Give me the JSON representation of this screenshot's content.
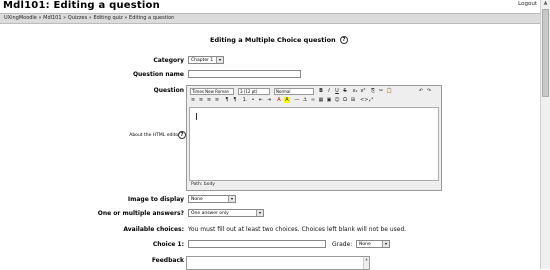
{
  "header": {
    "title": "Mdl101: Editing a question",
    "logout_label": "Logout"
  },
  "breadcrumb": "UXingMoodle » Mdl101 » Quizzes » Editing quiz » Editing a question",
  "form": {
    "title": "Editing a Multiple Choice question",
    "category": {
      "label": "Category",
      "value": "Chapter 1"
    },
    "question_name": {
      "label": "Question name",
      "value": ""
    },
    "question": {
      "label": "Question",
      "editor_help_label": "About the HTML editor",
      "font_value": "Times New Roman",
      "size_value": "3 (12 pt)",
      "style_value": "Normal",
      "path_label": "Path: body"
    },
    "image": {
      "label": "Image to display",
      "value": "None"
    },
    "answers": {
      "label": "One or multiple answers?",
      "value": "One answer only"
    },
    "available_choices": {
      "label": "Available choices:",
      "text": "You must fill out at least two choices. Choices left blank will not be used."
    },
    "choice1": {
      "label": "Choice 1:",
      "value": "",
      "grade_label": "Grade:",
      "grade_value": "None"
    },
    "feedback": {
      "label": "Feedback"
    }
  },
  "toolbar": {
    "row1_buttons": [
      "B",
      "I",
      "U",
      "S",
      "x₂",
      "x²",
      "⎘",
      "✂",
      "📋",
      "↶",
      "↷"
    ],
    "row2_buttons": [
      "≡",
      "≡",
      "≡",
      "≡",
      "¶",
      "¶",
      "1.",
      "•",
      "⇤",
      "⇥",
      "A",
      "A",
      "—",
      "⚓",
      "∞",
      "▦",
      "▣",
      "☺",
      "Ω",
      "⊞",
      "<>",
      "⤢"
    ]
  },
  "colors": {
    "navbar": "#dcdcdc",
    "background": "#ffffff"
  }
}
